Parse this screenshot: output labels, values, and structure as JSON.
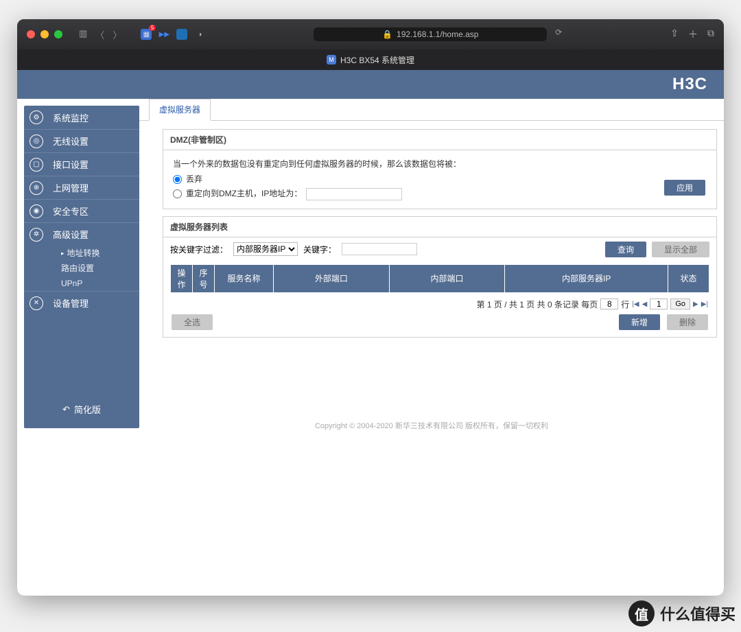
{
  "browser": {
    "url": "192.168.1.1/home.asp",
    "ext_badge": "5",
    "tab_title": "H3C BX54 系统管理"
  },
  "brand": "H3C",
  "sidebar": {
    "items": [
      {
        "label": "系统监控",
        "icon": "⚙"
      },
      {
        "label": "无线设置",
        "icon": "◎"
      },
      {
        "label": "接口设置",
        "icon": "▢"
      },
      {
        "label": "上网管理",
        "icon": "⊕"
      },
      {
        "label": "安全专区",
        "icon": "◉"
      },
      {
        "label": "高级设置",
        "icon": "✲"
      },
      {
        "label": "设备管理",
        "icon": "✕"
      }
    ],
    "sub": [
      "地址转换",
      "路由设置",
      "UPnP"
    ],
    "simple": "简化版"
  },
  "tab_virtual": "虚拟服务器",
  "dmz": {
    "title": "DMZ(非管制区)",
    "desc": "当一个外来的数据包没有重定向到任何虚拟服务器的时候，那么该数据包将被：",
    "opt_discard": "丢弃",
    "opt_redirect": "重定向到DMZ主机，IP地址为：",
    "apply": "应用"
  },
  "list": {
    "title": "虚拟服务器列表",
    "filter_label": "按关键字过滤：",
    "filter_select": "内部服务器IP",
    "kw_label": "关键字：",
    "query": "查询",
    "show_all": "显示全部",
    "cols": [
      "操作",
      "序号",
      "服务名称",
      "外部端口",
      "内部端口",
      "内部服务器IP",
      "状态"
    ],
    "page_info": "第 1 页 / 共 1 页 共 0 条记录 每页",
    "page_size": "8",
    "page_unit": "行",
    "page_num": "1",
    "go": "Go",
    "select_all": "全选",
    "add": "新增",
    "delete": "删除"
  },
  "footer": "Copyright © 2004-2020 新华三技术有限公司 版权所有，保留一切权利",
  "watermark": "什么值得买"
}
